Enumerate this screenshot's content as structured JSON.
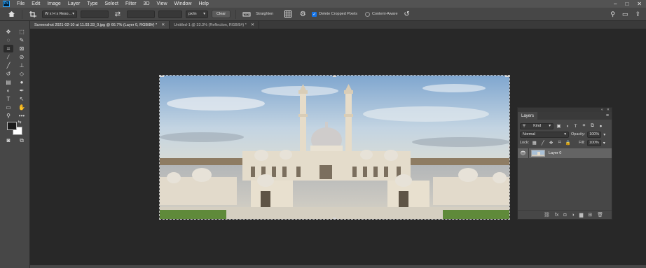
{
  "menubar": {
    "logo": "Ps",
    "items": [
      "File",
      "Edit",
      "Image",
      "Layer",
      "Type",
      "Select",
      "Filter",
      "3D",
      "View",
      "Window",
      "Help"
    ],
    "window_controls": [
      "–",
      "□",
      "✕"
    ]
  },
  "options": {
    "ratio": "W x H x Reso...",
    "units": "px/in",
    "clear": "Clear",
    "straighten": "Straighten",
    "delete_cropped": "Delete Cropped Pixels",
    "delete_cropped_checked": true,
    "content_aware": "Content-Aware",
    "content_aware_checked": false
  },
  "tabs": [
    {
      "label": "Screenshot 2021-02-10 at 11.03.33_0.jpg @ 66.7% (Layer 0, RGB/8#) *",
      "close": "✕"
    },
    {
      "label": "Untitled-1 @ 33.3% (Reflection, RGB/8#) *",
      "close": "✕"
    }
  ],
  "tools": {
    "move": "✥",
    "marquee": "⬚",
    "lasso": "◌",
    "quick_select": "✎",
    "crop": "⌗",
    "frame": "⊠",
    "eyedropper": "⁄",
    "spot_heal": "⊘",
    "brush": "╱",
    "stamp": "⊥",
    "history_brush": "↺",
    "eraser": "◇",
    "gradient": "▤",
    "blur": "●",
    "dodge": "◐",
    "pen": "✒",
    "type": "T",
    "path_select": "↖",
    "rectangle": "▭",
    "hand": "✋",
    "zoom": "⚲",
    "more": "•••",
    "fg_color": "#1c1c1c",
    "bg_color": "#ffffff"
  },
  "layers": {
    "panel_title": "Layers",
    "top_icons": [
      "«",
      "✕"
    ],
    "kind": "Kind",
    "blend_mode": "Normal",
    "opacity_label": "Opacity:",
    "opacity_value": "100%",
    "lock_label": "Lock:",
    "fill_label": "Fill:",
    "fill_value": "100%",
    "items": [
      {
        "name": "Layer 0",
        "visible_icon": "👁"
      }
    ],
    "bottom_icons": [
      "⛓",
      "fx",
      "◘",
      "◑",
      "▆",
      "⊞",
      "🗑"
    ]
  }
}
